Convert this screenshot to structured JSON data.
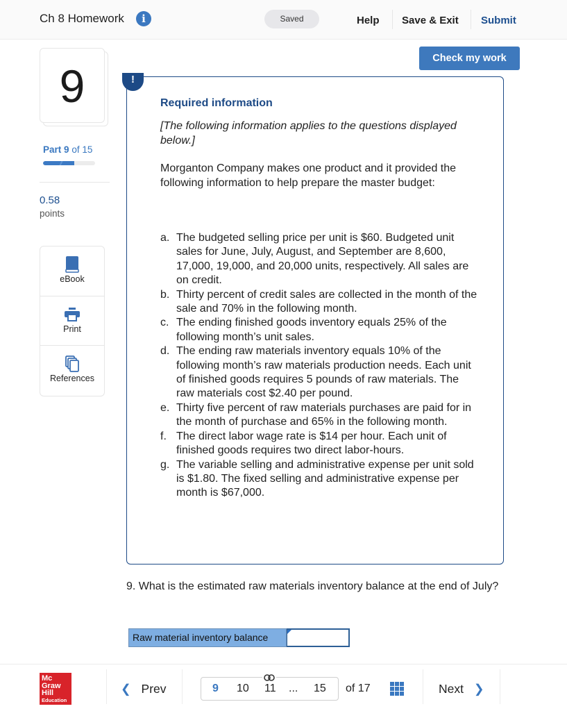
{
  "header": {
    "title": "Ch 8 Homework",
    "info_icon": "i",
    "status": "Saved",
    "links": {
      "help": "Help",
      "save_exit": "Save & Exit",
      "submit": "Submit"
    }
  },
  "sidebar": {
    "question_number": "9",
    "part": {
      "prefix": "Part",
      "current": "9",
      "of_text": "of 15"
    },
    "progress_fraction": 0.6,
    "points_value": "0.58",
    "points_label": "points",
    "tools": [
      {
        "label": "eBook",
        "icon": "book-icon"
      },
      {
        "label": "Print",
        "icon": "printer-icon"
      },
      {
        "label": "References",
        "icon": "documents-icon"
      }
    ]
  },
  "actions": {
    "check_work": "Check my work"
  },
  "required_info": {
    "badge": "!",
    "title": "Required information",
    "intro": "[The following information applies to the questions displayed below.]",
    "description": "Morganton Company makes one product and it provided the following information to help prepare the master budget:",
    "items": [
      {
        "mark": "a.",
        "text": "The budgeted selling price per unit is $60. Budgeted unit sales for June, July, August, and September are 8,600, 17,000, 19,000, and 20,000 units, respectively. All sales are on credit."
      },
      {
        "mark": "b.",
        "text": "Thirty percent of credit sales are collected in the month of the sale and 70% in the following month."
      },
      {
        "mark": "c.",
        "text": "The ending finished goods inventory equals 25% of the following month’s unit sales."
      },
      {
        "mark": "d.",
        "text": "The ending raw materials inventory equals 10% of the following month’s raw materials production needs. Each unit of finished goods requires 5 pounds of raw materials. The raw materials cost $2.40 per pound."
      },
      {
        "mark": "e.",
        "text": "Thirty five percent of raw materials purchases are paid for in the month of purchase and 65% in the following month."
      },
      {
        "mark": "f.",
        "text": "The direct labor wage rate is $14 per hour. Each unit of finished goods requires two direct labor-hours."
      },
      {
        "mark": "g.",
        "text": "The variable selling and administrative expense per unit sold is $1.80. The fixed selling and administrative expense per month is $67,000."
      }
    ]
  },
  "question": {
    "text": "9. What is the estimated raw materials inventory balance at the end of July?",
    "answer_label": "Raw material inventory balance",
    "answer_value": "",
    "answer_placeholder": ""
  },
  "footer": {
    "logo": {
      "line1": "Mc",
      "line2": "Graw",
      "line3": "Hill",
      "line4": "Education"
    },
    "prev": "Prev",
    "next": "Next",
    "pages": [
      "9",
      "10",
      "11",
      "...",
      "15"
    ],
    "current_page": "9",
    "of_text": "of",
    "total": "17"
  },
  "colors": {
    "accent": "#3a78c0",
    "navy": "#1d4a86",
    "check_button": "#3e79bd",
    "answer_label_bg": "#7eaee2",
    "logo_red": "#d8232a"
  }
}
